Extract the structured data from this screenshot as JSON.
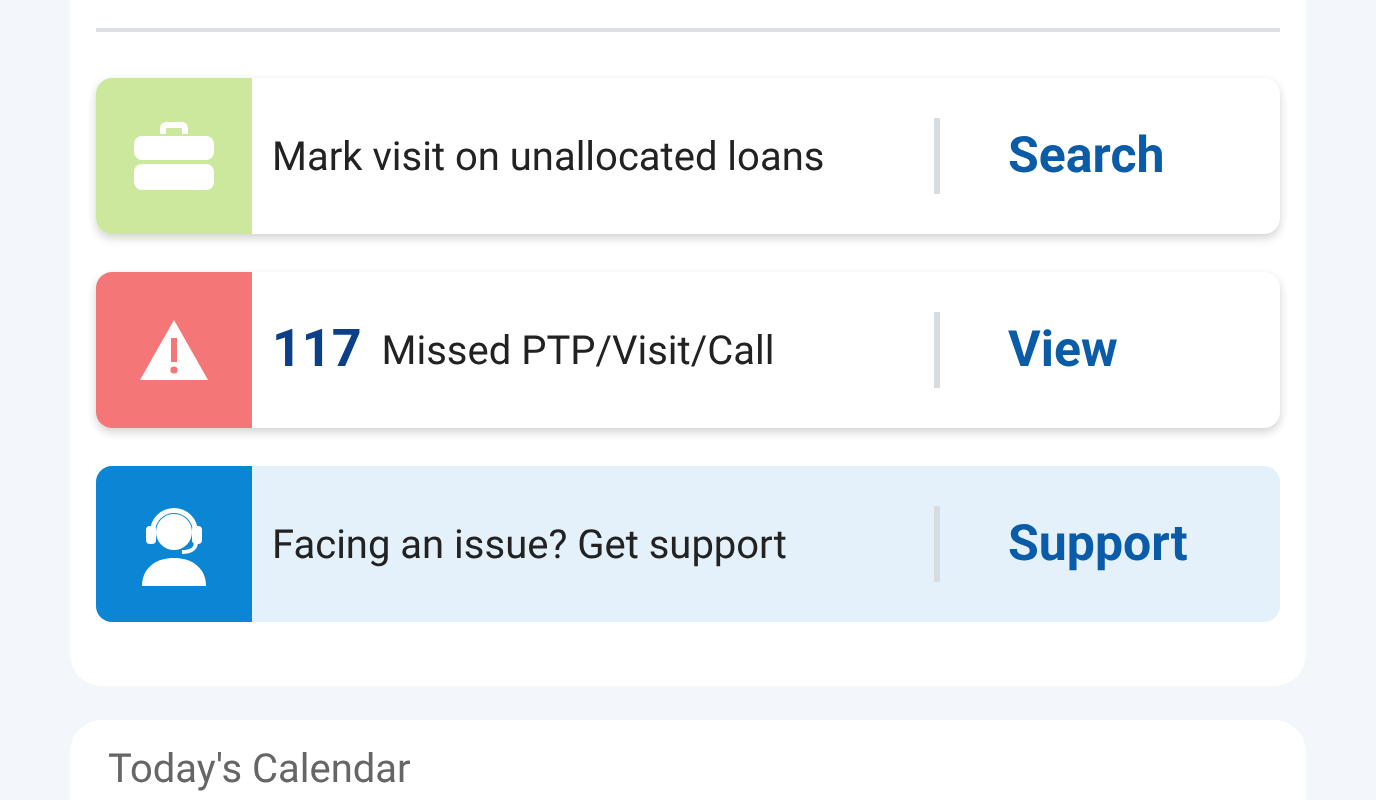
{
  "actions": [
    {
      "kind": "briefcase",
      "color": "#cbe89d",
      "tinted": false,
      "text": "Mark visit on unallocated loans",
      "action": "Search"
    },
    {
      "kind": "warning",
      "color": "#f47676",
      "tinted": false,
      "count": "117",
      "text": "Missed PTP/Visit/Call",
      "action": "View"
    },
    {
      "kind": "support",
      "color": "#0a86d4",
      "tinted": true,
      "text": "Facing an issue? Get support",
      "action": "Support"
    }
  ],
  "calendar": {
    "title": "Today's Calendar"
  }
}
